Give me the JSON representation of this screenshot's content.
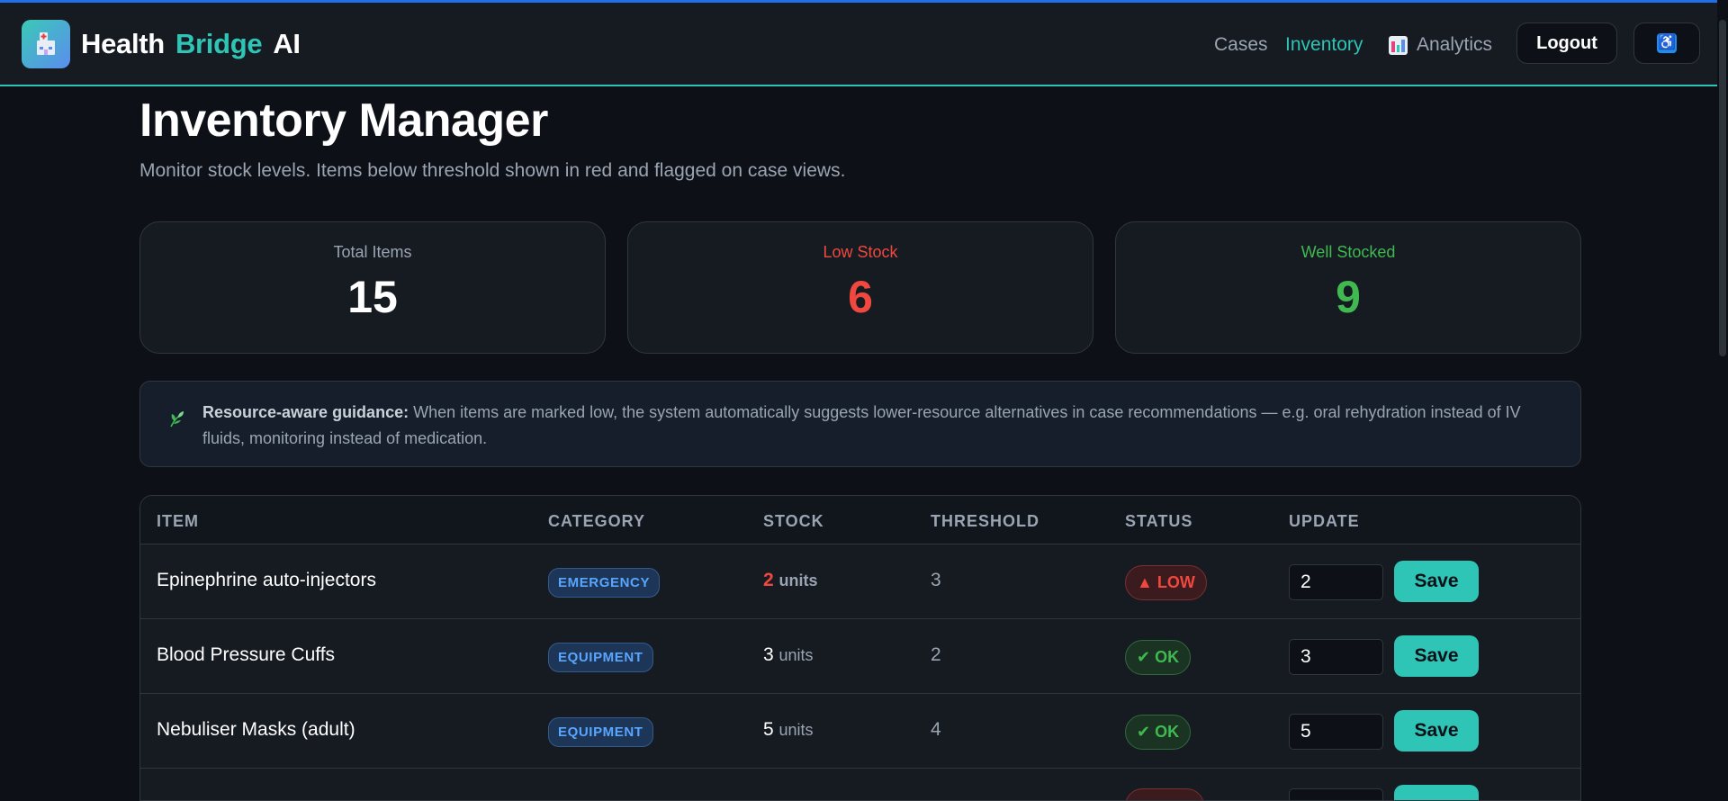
{
  "app": {
    "brand_part1": "Health",
    "brand_part2": "Bridge",
    "brand_part3": "AI",
    "accent_color": "#2ec4b6",
    "low_color": "#f0483e",
    "ok_color": "#3fb950"
  },
  "nav": {
    "cases": "Cases",
    "inventory": "Inventory",
    "analytics": "Analytics",
    "logout": "Logout",
    "accessibility_icon": "accessibility-icon"
  },
  "page": {
    "title": "Inventory Manager",
    "subtitle": "Monitor stock levels. Items below threshold shown in red and flagged on case views."
  },
  "stats": {
    "total_label": "Total Items",
    "total_value": "15",
    "low_label": "Low Stock",
    "low_value": "6",
    "well_label": "Well Stocked",
    "well_value": "9"
  },
  "guidance": {
    "heading": "Resource-aware guidance:",
    "text": " When items are marked low, the system automatically suggests lower-resource alternatives in case recommendations — e.g. oral rehydration instead of IV fluids, monitoring instead of medication.",
    "icon": "leaf-icon"
  },
  "table": {
    "headers": {
      "item": "ITEM",
      "category": "CATEGORY",
      "stock": "STOCK",
      "threshold": "THRESHOLD",
      "status": "STATUS",
      "update": "UPDATE"
    },
    "rows": [
      {
        "item": "Epinephrine auto-injectors",
        "category": "EMERGENCY",
        "stock": "2",
        "unit": "units",
        "threshold": "3",
        "status": "LOW",
        "input_value": "2",
        "save": "Save"
      },
      {
        "item": "Blood Pressure Cuffs",
        "category": "EQUIPMENT",
        "stock": "3",
        "unit": "units",
        "threshold": "2",
        "status": "OK",
        "input_value": "3",
        "save": "Save"
      },
      {
        "item": "Nebuliser Masks (adult)",
        "category": "EQUIPMENT",
        "stock": "5",
        "unit": "units",
        "threshold": "4",
        "status": "OK",
        "input_value": "5",
        "save": "Save"
      }
    ]
  }
}
